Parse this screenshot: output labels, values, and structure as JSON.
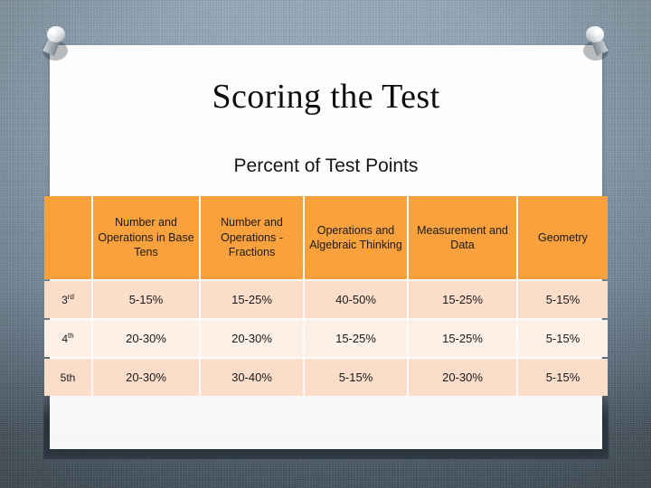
{
  "slide": {
    "title": "Scoring the Test",
    "subtitle": "Percent of Test Points"
  },
  "decor": {
    "pin_left": "pushpin-icon",
    "pin_right": "pushpin-icon",
    "paper": "paper-sheet",
    "background": "blue-gray-fabric"
  },
  "colors": {
    "header_orange": "#f9a13c",
    "row_odd": "#fbddc9",
    "row_even": "#fdf0e7",
    "header_text": "#ffffff",
    "body_text": "#1a1a1a",
    "paper": "#ffffff",
    "background_top": "#93a8b7",
    "background_bottom": "#4c5b67"
  },
  "table": {
    "corner_label": "",
    "headers": [
      "",
      "Number and Operations in Base Tens",
      "Number and Operations - Fractions",
      "Operations and Algebraic Thinking",
      "Measurement and Data",
      "Geometry"
    ],
    "rows": [
      {
        "grade": "3",
        "grade_suffix": "rd",
        "grade_suffix_superscript": true,
        "cells": [
          "5-15%",
          "15-25%",
          "40-50%",
          "15-25%",
          "5-15%"
        ]
      },
      {
        "grade": "4",
        "grade_suffix": "th",
        "grade_suffix_superscript": true,
        "cells": [
          "20-30%",
          "20-30%",
          "15-25%",
          "15-25%",
          "5-15%"
        ]
      },
      {
        "grade": "5th",
        "grade_suffix": "",
        "grade_suffix_superscript": false,
        "cells": [
          "20-30%",
          "30-40%",
          "5-15%",
          "20-30%",
          "5-15%"
        ]
      }
    ]
  }
}
